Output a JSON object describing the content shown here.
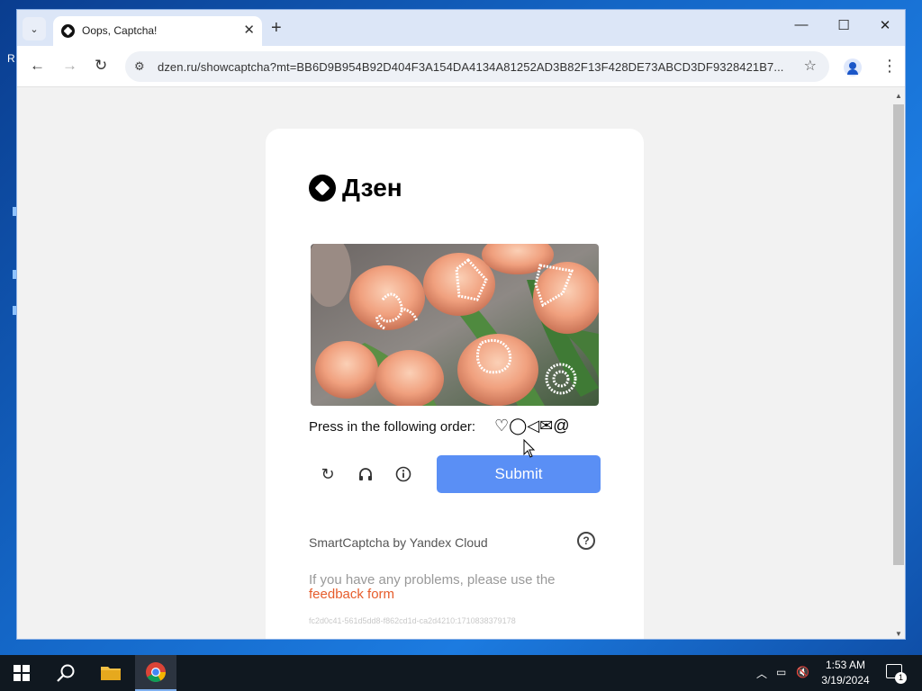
{
  "browser": {
    "tab_title": "Oops, Captcha!",
    "url": "dzen.ru/showcaptcha?mt=BB6D9B954B92D404F3A154DA4134A81252AD3B82F13F428DE73ABCD3DF9328421B7..."
  },
  "captcha": {
    "logo_text": "Дзен",
    "instruction": "Press in the following order:",
    "order_icons": "♡◯◁✉@",
    "submit_label": "Submit",
    "provider": "SmartCaptcha by Yandex Cloud",
    "problems_text": "If you have any problems, please use the",
    "feedback_link": "feedback form",
    "request_id": "fc2d0c41-561d5dd8-f862cd1d-ca2d4210:1710838379178"
  },
  "taskbar": {
    "time": "1:53 AM",
    "date": "3/19/2024",
    "notification_count": "1"
  },
  "colors": {
    "accent": "#5a8ff5",
    "link": "#e65c2b"
  }
}
